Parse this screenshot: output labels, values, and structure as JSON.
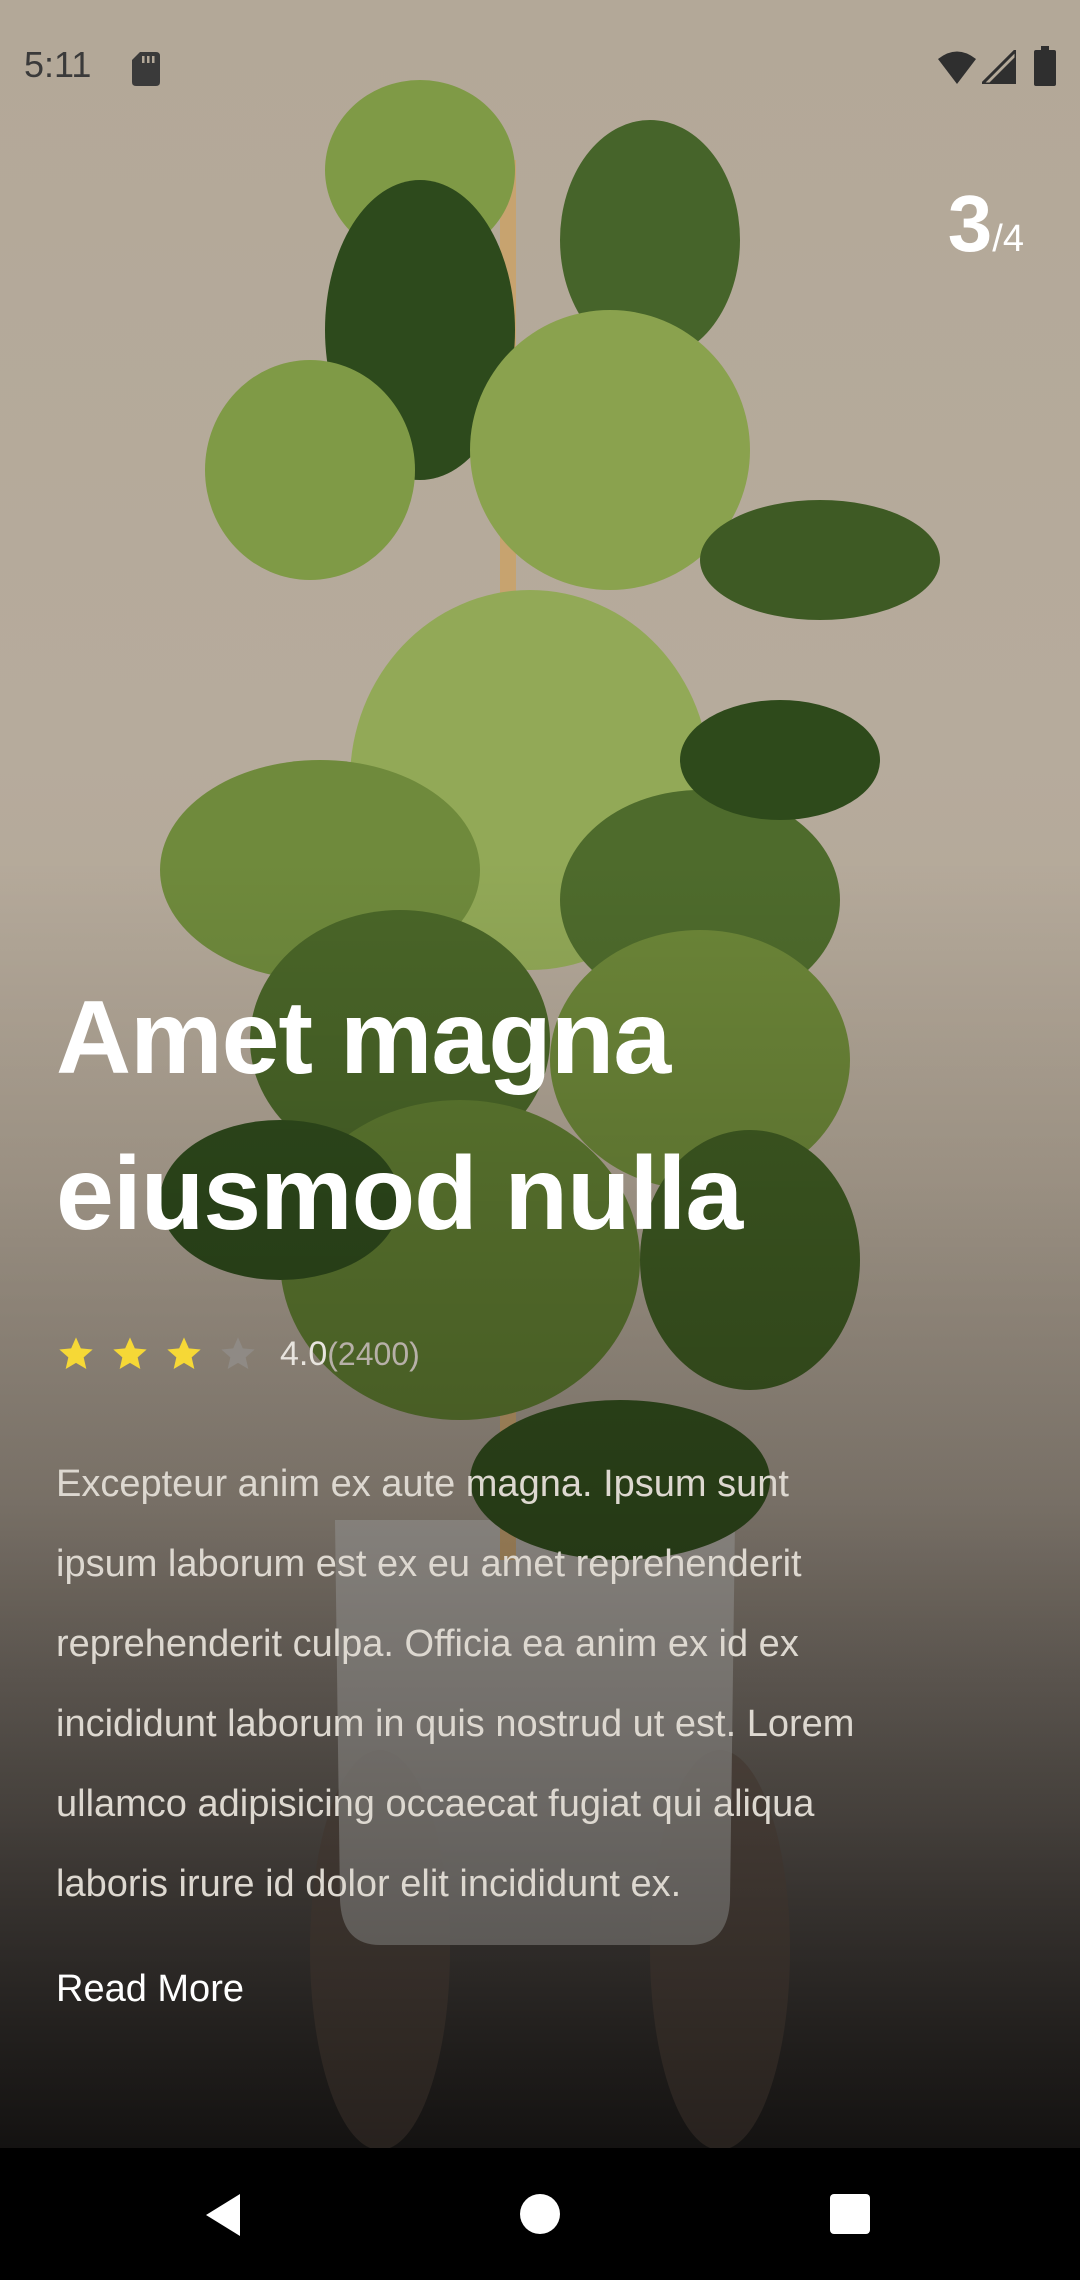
{
  "status_bar": {
    "time": "5:11",
    "icons": [
      "sd-card-icon",
      "wifi-icon",
      "cell-signal-icon",
      "battery-icon"
    ]
  },
  "pager": {
    "current": "3",
    "total": "/4"
  },
  "product": {
    "title": "Amet magna eiusmod nulla",
    "rating_value": "4.0",
    "rating_count": "(2400)",
    "rating_stars_filled": 3,
    "rating_stars_total": 4,
    "description": "Excepteur anim ex aute magna. Ipsum sunt ipsum laborum est ex eu amet reprehenderit reprehenderit culpa. Officia ea anim ex id ex incididunt laborum in quis nostrud ut est. Lorem ullamco adipisicing occaecat fugiat qui aliqua laboris irure id dolor elit incididunt ex.",
    "read_more_label": "Read More"
  },
  "nav_bar": {
    "icons": [
      "back-icon",
      "home-icon",
      "recents-icon"
    ]
  },
  "colors": {
    "star_filled": "#f6d836",
    "star_empty": "#8f8a85",
    "background": "#b3a898"
  }
}
